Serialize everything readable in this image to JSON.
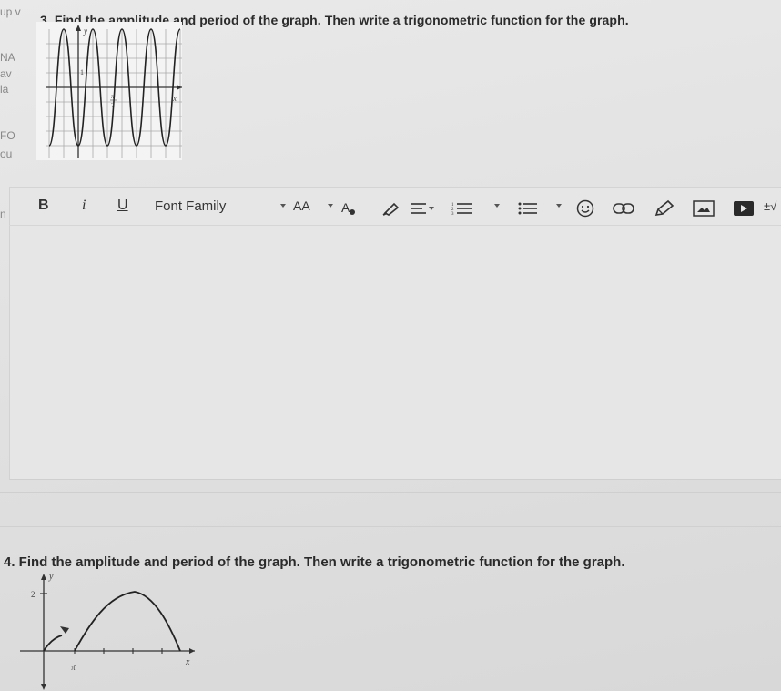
{
  "sidebar": {
    "fragments": [
      "up v",
      "NA",
      "av",
      "la",
      "FO",
      "ou",
      "n"
    ]
  },
  "question3": {
    "text": "3. Find the amplitude and period of the graph. Then write a trigonometric function for the graph.",
    "graph_labels": {
      "y": "y",
      "x": "x",
      "one": "1",
      "pi": "π",
      "two": "2"
    }
  },
  "toolbar": {
    "bold": "B",
    "italic": "i",
    "underline": "U",
    "font_family": "Font Family",
    "font_size": "AA",
    "text_color": "A",
    "math": "±√"
  },
  "question4": {
    "text": "4. Find the amplitude and period of the graph. Then write a trigonometric function for the graph.",
    "graph_labels": {
      "y": "y",
      "x": "x",
      "two": "2",
      "tick": "π̄"
    }
  },
  "colors": {
    "background": "#e3e3e3",
    "text": "#2b2b2b",
    "icon": "#333333"
  }
}
